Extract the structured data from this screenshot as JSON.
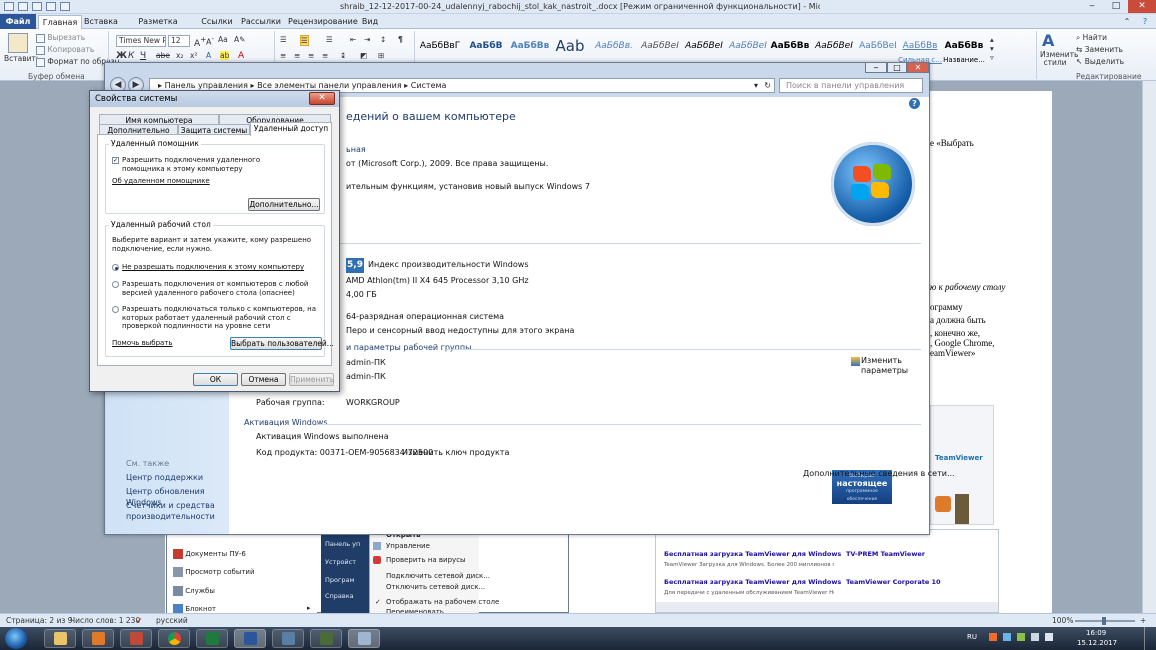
{
  "word": {
    "title": "shraib_12-12-2017-00-24_udalennyj_rabochij_stol_kak_nastroit_.docx [Режим ограниченной функциональности] - Microsoft Word",
    "tabs": [
      "Файл",
      "Главная",
      "Вставка",
      "Разметка страницы",
      "Ссылки",
      "Рассылки",
      "Рецензирование",
      "Вид"
    ],
    "ribbon": {
      "paste": "Вставить",
      "cut": "Вырезать",
      "copy": "Копировать",
      "format_painter": "Формат по образц",
      "clipboard_group": "Буфер обмена",
      "font_name": "Times New Rc",
      "font_size": "12",
      "styles": [
        {
          "sample": "АаБбВвГ",
          "name": ""
        },
        {
          "sample": "АаБбВ",
          "name": ""
        },
        {
          "sample": "АаБбВв",
          "name": ""
        },
        {
          "sample": "Aab",
          "name": ""
        },
        {
          "sample": "АаБбВв.",
          "name": ""
        },
        {
          "sample": "АаБбВеІ",
          "name": ""
        },
        {
          "sample": "АаБбВеІ",
          "name": ""
        },
        {
          "sample": "АаБбВеІ",
          "name": ""
        },
        {
          "sample": "АаБбВв",
          "name": ""
        },
        {
          "sample": "АаБбВеІ",
          "name": ""
        },
        {
          "sample": "АаБбВеІ",
          "name": ""
        },
        {
          "sample": "АаБбВв",
          "name": "Сильная с..."
        },
        {
          "sample": "АаБбВв",
          "name": "Название..."
        }
      ],
      "change_styles": "Изменить стили",
      "find": "Найти",
      "replace": "Заменить",
      "select": "Выделить",
      "editing_group": "Редактирование"
    },
    "doc_right_text": [
      "е «Выбрать",
      "ю к рабочему столу",
      "ограмму",
      "а должна быть",
      ", конечно же,",
      ",  Google Chrome,",
      "eamViewer»"
    ],
    "status": {
      "page": "Страница: 2 из 9",
      "words": "Число слов: 1 230",
      "lang": "русский",
      "zoom": "100%"
    }
  },
  "explorer": {
    "breadcrumb": [
      "Панель управления",
      "Все элементы панели управления",
      "Система"
    ],
    "search_placeholder": "Поиск в панели управления",
    "heading": "едений о вашем компьютере",
    "edition_header": "ьная",
    "copyright": "от (Microsoft Corp.), 2009. Все права защищены.",
    "upgrade_link": "ительным функциям, установив новый выпуск Windows 7",
    "rating_score": "5,9",
    "rating_link": "Индекс производительности Windows",
    "processor": "AMD Athlon(tm) II X4 645 Processor   3,10 GHz",
    "ram": "4,00 ГБ",
    "system_type": "64-разрядная операционная система",
    "pen_touch": "Перо и сенсорный ввод недоступны для этого экрана",
    "names_header": "и параметры рабочей группы",
    "computer_name": "admin-ПК",
    "full_name": "admin-ПК",
    "workgroup_label": "Рабочая группа:",
    "workgroup": "WORKGROUP",
    "change_settings": "Изменить параметры",
    "activation_header": "Активация Windows",
    "activation_status": "Активация Windows выполнена",
    "product_id_label": "Код продукта: 00371-OEM-9056834-72500",
    "change_key": "Изменить ключ продукта",
    "genuine_badge": [
      "Выбирай",
      "настоящее",
      "программное обеспечение",
      "Microsoft"
    ],
    "more_info": "Дополнительные сведения в сети...",
    "see_also": "См. также",
    "side_links": [
      "Центр поддержки",
      "Центр обновления Windows",
      "Счетчики и средства производительности"
    ]
  },
  "dialog": {
    "title": "Свойства системы",
    "tabs_back": [
      "Имя компьютера",
      "Оборудование"
    ],
    "tabs_front": [
      "Дополнительно",
      "Защита системы",
      "Удаленный доступ"
    ],
    "assist_group": "Удаленный помощник",
    "assist_checkbox": "Разрешить подключения удаленного помощника к этому компьютеру",
    "assist_link": "Об удаленном помощнике",
    "advanced_btn": "Дополнительно...",
    "rdp_group": "Удаленный рабочий стол",
    "rdp_desc": "Выберите вариант и затем укажите, кому разрешено подключение, если нужно.",
    "rdp_options": [
      "Не разрешать подключения к этому компьютеру",
      "Разрешать подключения от компьютеров с любой версией удаленного рабочего стола (опаснее)",
      "Разрешать подключаться только с компьютеров, на которых работает удаленный рабочий стол с проверкой подлинности на уровне сети"
    ],
    "help_link": "Помочь выбрать",
    "select_users_btn": "Выбрать пользователей...",
    "ok": "ОК",
    "cancel": "Отмена",
    "apply": "Применить"
  },
  "start_menu": {
    "left_items": [
      "Документы ПУ-6",
      "Просмотр событий",
      "Службы",
      "Блокнот"
    ],
    "right_items": [
      "Панель уп",
      "Устройст",
      "Програм",
      "Справка"
    ],
    "context_items": [
      "Открыть",
      "Управление",
      "Проверить на вирусы",
      "Подключить сетевой диск...",
      "Отключить сетевой диск...",
      "Отображать на рабочем столе",
      "Переименовать"
    ]
  },
  "thumb": {
    "links": [
      "Бесплатная загрузка TeamViewer для Windows",
      "Бесплатная загрузка TeamViewer для Windows"
    ],
    "snips": [
      "TeamViewer Загрузка для Windows. Более 200 миллионов пользователей в более чем",
      "Для передачи с удаленным обслуживанием TeamViewer Host"
    ],
    "right_links": [
      "TV-PREM TeamViewer",
      "TeamViewer Corporate 10"
    ],
    "header": "TeamViewer"
  },
  "tray": {
    "lang": "RU",
    "time": "16:09",
    "date": "15.12.2017"
  }
}
